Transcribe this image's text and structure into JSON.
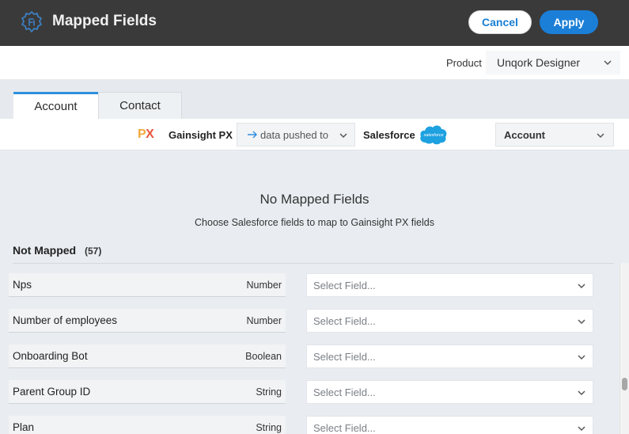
{
  "header": {
    "title": "Mapped Fields",
    "cancel_label": "Cancel",
    "apply_label": "Apply",
    "icon": "gear-icon"
  },
  "product": {
    "label": "Product",
    "value": "Unqork Designer"
  },
  "tabs": [
    {
      "label": "Account",
      "active": true
    },
    {
      "label": "Contact",
      "active": false
    }
  ],
  "mapping": {
    "source_logo": "PX",
    "source_name": "Gainsight PX",
    "direction": "data pushed to",
    "target_name": "Salesforce",
    "target_logo_text": "salesforce",
    "object": "Account"
  },
  "empty_state": {
    "title": "No Mapped Fields",
    "subtitle": "Choose Salesforce fields to map to Gainsight PX fields"
  },
  "not_mapped": {
    "title": "Not Mapped",
    "count": "(57)",
    "placeholder": "Select Field...",
    "fields": [
      {
        "name": "Nps",
        "type": "Number"
      },
      {
        "name": "Number of employees",
        "type": "Number"
      },
      {
        "name": "Onboarding Bot",
        "type": "Boolean"
      },
      {
        "name": "Parent Group ID",
        "type": "String"
      },
      {
        "name": "Plan",
        "type": "String"
      }
    ]
  },
  "colors": {
    "header_bg": "#3a3a3a",
    "accent": "#1b7fd8",
    "salesforce": "#1ea1e0",
    "px_orange": "#f2a93b",
    "px_red": "#e8553a"
  }
}
